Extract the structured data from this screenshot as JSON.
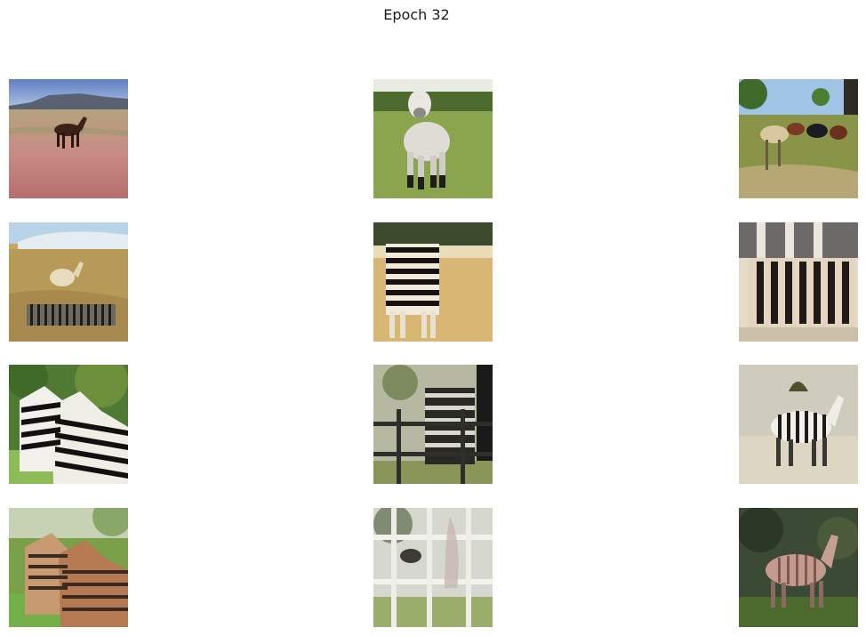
{
  "figure": {
    "title": "Epoch 32"
  },
  "grid": {
    "rows": 4,
    "cols": 3,
    "cells": [
      {
        "name": "cell-r1-c1",
        "icon": "horse-dark-on-meadow-image"
      },
      {
        "name": "cell-r1-c2",
        "icon": "white-horse-on-grass-image"
      },
      {
        "name": "cell-r1-c3",
        "icon": "horses-in-pasture-image"
      },
      {
        "name": "cell-r2-c1",
        "icon": "zebra-herd-plains-image"
      },
      {
        "name": "cell-r2-c2",
        "icon": "zebra-on-sand-image"
      },
      {
        "name": "cell-r2-c3",
        "icon": "zebra-by-stable-image"
      },
      {
        "name": "cell-r3-c1",
        "icon": "two-zebras-forest-image"
      },
      {
        "name": "cell-r3-c2",
        "icon": "zebra-behind-fence-image"
      },
      {
        "name": "cell-r3-c3",
        "icon": "zebra-in-savanna-image"
      },
      {
        "name": "cell-r4-c1",
        "icon": "two-zebras-grass-image"
      },
      {
        "name": "cell-r4-c2",
        "icon": "faded-fence-scene-image"
      },
      {
        "name": "cell-r4-c3",
        "icon": "striped-horse-dark-bg-image"
      }
    ]
  }
}
